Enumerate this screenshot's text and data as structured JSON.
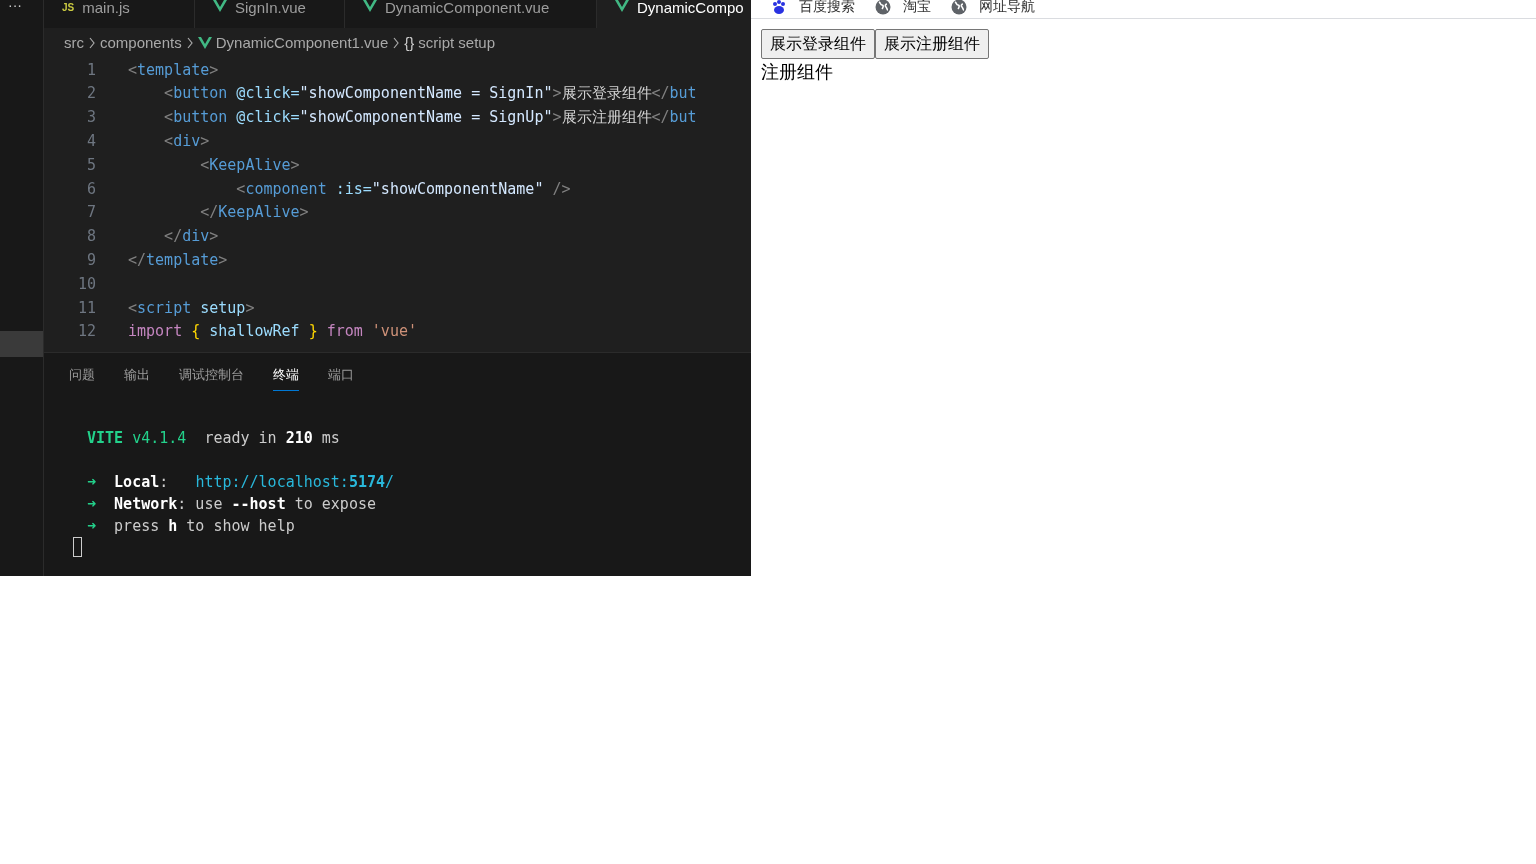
{
  "editor": {
    "more_icon": "···",
    "tabs": [
      {
        "label": "main.js",
        "kind": "js",
        "icon": "JS",
        "selected": false
      },
      {
        "label": "SignIn.vue",
        "kind": "vue",
        "selected": false
      },
      {
        "label": "DynamicComponent.vue",
        "kind": "vue",
        "selected": false
      },
      {
        "label": "DynamicCompo",
        "kind": "vue",
        "selected": true
      }
    ],
    "breadcrumb": [
      {
        "label": "src",
        "kind": "folder"
      },
      {
        "label": "components",
        "kind": "folder"
      },
      {
        "label": "DynamicComponent1.vue",
        "kind": "vue"
      },
      {
        "label": "script setup",
        "kind": "braces",
        "icon": "{}"
      }
    ],
    "lines": [
      {
        "number": "1",
        "tokens": [
          {
            "text": "<",
            "kind": "punct"
          },
          {
            "text": "template",
            "kind": "tag"
          },
          {
            "text": ">",
            "kind": "punct"
          }
        ]
      },
      {
        "number": "2",
        "tokens": [
          {
            "text": "    <",
            "kind": "punct"
          },
          {
            "text": "button",
            "kind": "tag"
          },
          {
            "text": " @click=",
            "kind": "attr"
          },
          {
            "text": "\"showComponentName = SignIn\"",
            "kind": "expr"
          },
          {
            "text": ">",
            "kind": "punct"
          },
          {
            "text": "展示登录组件",
            "kind": "text"
          },
          {
            "text": "</",
            "kind": "punct"
          },
          {
            "text": "but",
            "kind": "tag"
          }
        ]
      },
      {
        "number": "3",
        "tokens": [
          {
            "text": "    <",
            "kind": "punct"
          },
          {
            "text": "button",
            "kind": "tag"
          },
          {
            "text": " @click=",
            "kind": "attr"
          },
          {
            "text": "\"showComponentName = SignUp\"",
            "kind": "expr"
          },
          {
            "text": ">",
            "kind": "punct"
          },
          {
            "text": "展示注册组件",
            "kind": "text"
          },
          {
            "text": "</",
            "kind": "punct"
          },
          {
            "text": "but",
            "kind": "tag"
          }
        ]
      },
      {
        "number": "4",
        "tokens": [
          {
            "text": "    <",
            "kind": "punct"
          },
          {
            "text": "div",
            "kind": "tag"
          },
          {
            "text": ">",
            "kind": "punct"
          }
        ]
      },
      {
        "number": "5",
        "tokens": [
          {
            "text": "        <",
            "kind": "punct"
          },
          {
            "text": "KeepAlive",
            "kind": "tag"
          },
          {
            "text": ">",
            "kind": "punct"
          }
        ]
      },
      {
        "number": "6",
        "tokens": [
          {
            "text": "            <",
            "kind": "punct"
          },
          {
            "text": "component",
            "kind": "tag"
          },
          {
            "text": " :is=",
            "kind": "attr"
          },
          {
            "text": "\"showComponentName\"",
            "kind": "expr"
          },
          {
            "text": " />",
            "kind": "punct"
          }
        ]
      },
      {
        "number": "7",
        "tokens": [
          {
            "text": "        </",
            "kind": "punct"
          },
          {
            "text": "KeepAlive",
            "kind": "tag"
          },
          {
            "text": ">",
            "kind": "punct"
          }
        ]
      },
      {
        "number": "8",
        "tokens": [
          {
            "text": "    </",
            "kind": "punct"
          },
          {
            "text": "div",
            "kind": "tag"
          },
          {
            "text": ">",
            "kind": "punct"
          }
        ]
      },
      {
        "number": "9",
        "tokens": [
          {
            "text": "</",
            "kind": "punct"
          },
          {
            "text": "template",
            "kind": "tag"
          },
          {
            "text": ">",
            "kind": "punct"
          }
        ]
      },
      {
        "number": "10"
      },
      {
        "number": "11",
        "tokens": [
          {
            "text": "<",
            "kind": "punct"
          },
          {
            "text": "script",
            "kind": "tag"
          },
          {
            "text": " setup",
            "kind": "attr"
          },
          {
            "text": ">",
            "kind": "punct"
          }
        ]
      },
      {
        "number": "12",
        "tokens": [
          {
            "text": "import",
            "kind": "keyword"
          },
          {
            "text": " {",
            "kind": "brace"
          },
          {
            "text": " shallowRef ",
            "kind": "attr"
          },
          {
            "text": "}",
            "kind": "brace"
          },
          {
            "text": " from",
            "kind": "keyword"
          },
          {
            "text": " 'vue'",
            "kind": "string"
          }
        ]
      }
    ]
  },
  "panel": {
    "tabs": [
      {
        "label": "问题",
        "selected": false
      },
      {
        "label": "输出",
        "selected": false
      },
      {
        "label": "调试控制台",
        "selected": false
      },
      {
        "label": "终端",
        "selected": true
      },
      {
        "label": "端口",
        "selected": false
      }
    ],
    "terminal": [
      {
        "tokens": [
          {
            "text": "VITE",
            "kind": "green-bold"
          },
          {
            "text": " v4.1.4",
            "kind": "green"
          },
          {
            "text": "  ready in ",
            "kind": "plain"
          },
          {
            "text": "210",
            "kind": "bold"
          },
          {
            "text": " ms",
            "kind": "plain"
          }
        ]
      },
      {
        "blank_before": true,
        "tokens": [
          {
            "text": "➜  ",
            "kind": "green-bold"
          },
          {
            "text": "Local",
            "kind": "bold"
          },
          {
            "text": ":   ",
            "kind": "plain"
          },
          {
            "text": "http://localhost:",
            "kind": "cyan"
          },
          {
            "text": "5174",
            "kind": "cyan-bold"
          },
          {
            "text": "/",
            "kind": "cyan"
          }
        ]
      },
      {
        "tokens": [
          {
            "text": "➜  ",
            "kind": "green-bold"
          },
          {
            "text": "Network",
            "kind": "bold"
          },
          {
            "text": ": use ",
            "kind": "plain"
          },
          {
            "text": "--host",
            "kind": "bold"
          },
          {
            "text": " to expose",
            "kind": "plain"
          }
        ]
      },
      {
        "tokens": [
          {
            "text": "➜",
            "kind": "green-bold"
          },
          {
            "text": "  press ",
            "kind": "plain"
          },
          {
            "text": "h",
            "kind": "bold"
          },
          {
            "text": " to show help",
            "kind": "plain"
          }
        ]
      }
    ]
  },
  "browser": {
    "bookmarks": [
      {
        "label": "百度搜索",
        "kind": "paw"
      },
      {
        "label": "淘宝",
        "kind": "globe"
      },
      {
        "label": "网址导航",
        "kind": "globe"
      }
    ],
    "buttons": [
      "展示登录组件",
      "展示注册组件"
    ],
    "content": "注册组件"
  }
}
